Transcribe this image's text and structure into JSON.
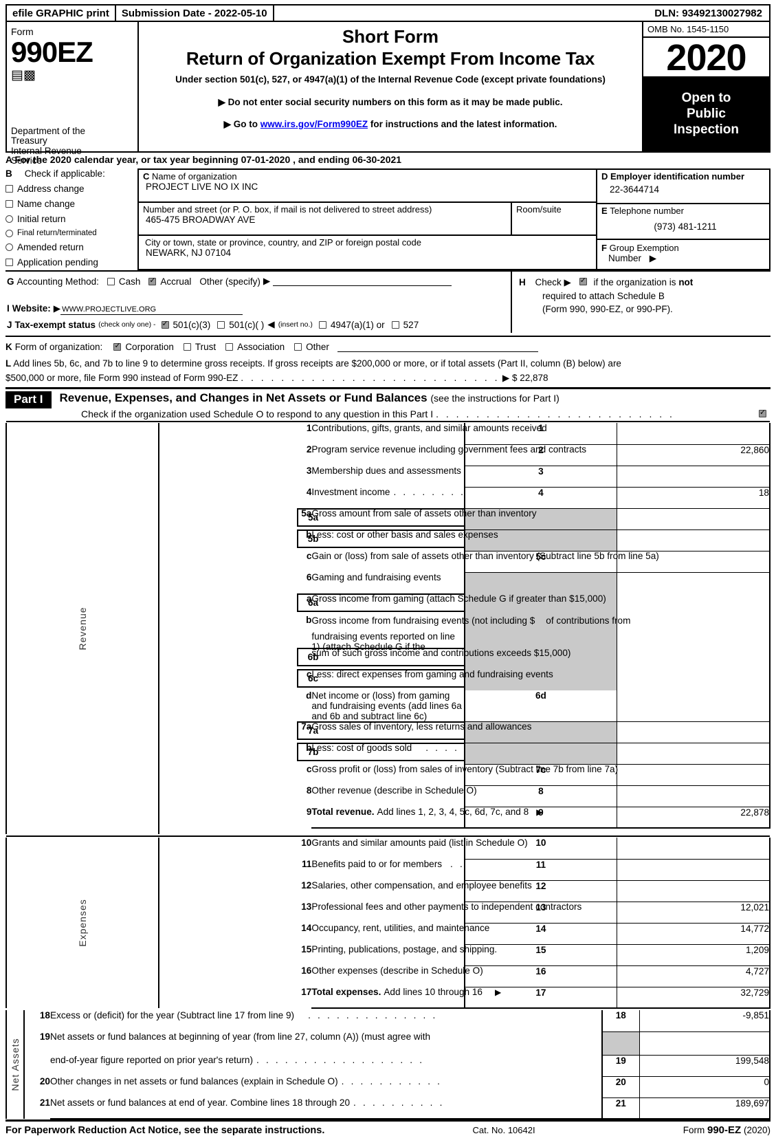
{
  "efile": {
    "graphic_print": "efile GRAPHIC print",
    "submission_date": "Submission Date - 2022-05-10",
    "dln": "DLN: 93492130027982"
  },
  "masthead": {
    "form_label": "Form",
    "form_number": "990EZ",
    "department_line1": "Department of the",
    "department_line2": "Treasury",
    "department_line3": "Internal Revenue",
    "department_line4": "Service",
    "title_short": "Short Form",
    "title_main": "Return of Organization Exempt From Income Tax",
    "subtitle": "Under section 501(c), 527, or 4947(a)(1) of the Internal Revenue Code (except private foundations)",
    "bullet1": "Do not enter social security numbers on this form as it may be made public.",
    "bullet2_prefix": "Go to",
    "bullet2_link": "www.irs.gov/Form990EZ",
    "bullet2_suffix": "for instructions and the latest information.",
    "omb": "OMB No. 1545-1150",
    "year": "2020",
    "open_line1": "Open to",
    "open_line2": "Public",
    "open_line3": "Inspection"
  },
  "line_a": "A  For the 2020 calendar year, or tax year beginning 07-01-2020 , and ending 06-30-2021",
  "section_b": {
    "letter": "B",
    "title": "Check if applicable:",
    "options": [
      {
        "label": "Address change",
        "checked": false,
        "shape": "square"
      },
      {
        "label": "Name change",
        "checked": false,
        "shape": "square"
      },
      {
        "label": "Initial return",
        "checked": false,
        "shape": "round"
      },
      {
        "label": "Final return/terminated",
        "checked": false,
        "shape": "round",
        "small": true
      },
      {
        "label": "Amended return",
        "checked": false,
        "shape": "round"
      },
      {
        "label": "Application pending",
        "checked": false,
        "shape": "square"
      }
    ]
  },
  "section_c": {
    "letter": "C",
    "label": "Name of organization",
    "value": "PROJECT LIVE NO IX INC",
    "street_label": "Number and street (or P. O. box, if mail is not delivered to street address)",
    "street_value": "465-475 BROADWAY AVE",
    "room_label": "Room/suite",
    "room_value": "",
    "city_label": "City or town, state or province, country, and ZIP or foreign postal code",
    "city_value": "NEWARK, NJ   07104"
  },
  "section_d": {
    "letter": "D",
    "label": "Employer identification number",
    "value": "22-3644714"
  },
  "section_e": {
    "letter": "E",
    "label": "Telephone number",
    "value": "(973) 481-1211"
  },
  "section_f": {
    "letter": "F",
    "label": "Group Exemption",
    "label2": "Number",
    "value": ""
  },
  "section_g": {
    "letter": "G",
    "label": "Accounting Method:",
    "cash": "Cash",
    "cash_checked": false,
    "accrual": "Accrual",
    "accrual_checked": true,
    "other": "Other (specify)",
    "other_value": ""
  },
  "section_h": {
    "letter": "H",
    "label": "Check",
    "checked": true,
    "text1": "if the organization is",
    "text_not": "not",
    "text2": "required to attach Schedule B",
    "text3": "(Form 990, 990-EZ, or 990-PF)."
  },
  "section_i": {
    "letter": "I",
    "label": "Website:",
    "value": "WWW.PROJECTLIVE.ORG"
  },
  "section_j": {
    "letter": "J",
    "label": "Tax-exempt status",
    "note": "(check only one) -",
    "options": [
      {
        "label": "501(c)(3)",
        "checked": true
      },
      {
        "label": "501(c)(   )",
        "checked": false
      },
      {
        "label": "4947(a)(1) or",
        "checked": false
      },
      {
        "label": "527",
        "checked": false
      }
    ],
    "insert_note": "(insert no.)"
  },
  "section_k": {
    "letter": "K",
    "label": "Form of organization:",
    "options": [
      {
        "label": "Corporation",
        "checked": true
      },
      {
        "label": "Trust",
        "checked": false
      },
      {
        "label": "Association",
        "checked": false
      },
      {
        "label": "Other",
        "checked": false
      }
    ]
  },
  "section_l": {
    "letter": "L",
    "text1": "Add lines 5b, 6c, and 7b to line 9 to determine gross receipts. If gross receipts are $200,000 or more, or if total assets (Part II, column (B) below) are",
    "text2": "$500,000 or more, file Form 990 instead of Form 990-EZ",
    "amount": "$ 22,878"
  },
  "part1": {
    "tag": "Part I",
    "title": "Revenue, Expenses, and Changes in Net Assets or Fund Balances",
    "title_note": "(see the instructions for Part I)",
    "check_text": "Check if the organization used Schedule O to respond to any question in this Part I",
    "checked": true
  },
  "sections": {
    "revenue_label": "Revenue",
    "expenses_label": "Expenses",
    "netassets_label": "Net Assets"
  },
  "revenue_rows": [
    {
      "num": "1",
      "desc": "Contributions, gifts, grants, and similar amounts received",
      "box": "1",
      "value": "",
      "dots": true
    },
    {
      "num": "2",
      "desc": "Program service revenue including government fees and contracts",
      "box": "2",
      "value": "22,860",
      "dots": true
    },
    {
      "num": "3",
      "desc": "Membership dues and assessments",
      "box": "3",
      "value": "",
      "dots": true
    },
    {
      "num": "4",
      "desc": "Investment income",
      "box": "4",
      "value": "18",
      "dots": true
    },
    {
      "num": "5a",
      "desc": "Gross amount from sale of assets other than inventory",
      "sub_box": "5a",
      "sub_value": "",
      "gray": true,
      "dots": true
    },
    {
      "num": "b",
      "desc": "Less: cost or other basis and sales expenses",
      "sub_box": "5b",
      "sub_value": "",
      "gray": true,
      "dots": true
    },
    {
      "num": "c",
      "desc": "Gain or (loss) from sale of assets other than inventory (Subtract line 5b from line 5a)",
      "box": "5c",
      "value": "",
      "dots": true
    },
    {
      "num": "6",
      "desc": "Gaming and fundraising events",
      "gray": true,
      "dots": false
    },
    {
      "num": "a",
      "desc": "Gross income from gaming (attach Schedule G if greater than $15,000)",
      "sub_box": "6a",
      "sub_value": "",
      "gray": true,
      "dots": false
    },
    {
      "num": "b",
      "desc": "Gross income from fundraising events (not including $",
      "desc2": "of contributions from",
      "desc3": "fundraising events reported on line 1) (attach Schedule G if the",
      "desc4": "sum of such gross income and contributions exceeds $15,000)",
      "sub_box": "6b",
      "sub_value": "",
      "gray": true,
      "dots": true
    },
    {
      "num": "c",
      "desc": "Less: direct expenses from gaming and fundraising events",
      "sub_box": "6c",
      "sub_value": "",
      "gray": true,
      "dots": true
    },
    {
      "num": "d",
      "desc": "Net income or (loss) from gaming and fundraising events (add lines 6a and 6b and subtract line 6c)",
      "box": "6d",
      "value": "",
      "dots": false
    },
    {
      "num": "7a",
      "desc": "Gross sales of inventory, less returns and allowances",
      "sub_box": "7a",
      "sub_value": "",
      "gray": true,
      "dots": true
    },
    {
      "num": "b",
      "desc": "Less: cost of goods sold",
      "sub_box": "7b",
      "sub_value": "",
      "gray": true,
      "dots": true
    },
    {
      "num": "c",
      "desc": "Gross profit or (loss) from sales of inventory (Subtract line 7b from line 7a)",
      "box": "7c",
      "value": "",
      "dots": true
    },
    {
      "num": "8",
      "desc": "Other revenue (describe in Schedule O)",
      "box": "8",
      "value": "",
      "dots": true
    },
    {
      "num": "9",
      "desc_bold": "Total revenue.",
      "desc": "Add lines 1, 2, 3, 4, 5c, 6d, 7c, and 8",
      "box": "9",
      "value": "22,878",
      "dots": true,
      "arrow": true
    }
  ],
  "expense_rows": [
    {
      "num": "10",
      "desc": "Grants and similar amounts paid (list in Schedule O)",
      "box": "10",
      "value": "",
      "dots": true
    },
    {
      "num": "11",
      "desc": "Benefits paid to or for members",
      "box": "11",
      "value": "",
      "dots": true
    },
    {
      "num": "12",
      "desc": "Salaries, other compensation, and employee benefits",
      "box": "12",
      "value": "",
      "dots": true
    },
    {
      "num": "13",
      "desc": "Professional fees and other payments to independent contractors",
      "box": "13",
      "value": "12,021",
      "dots": true
    },
    {
      "num": "14",
      "desc": "Occupancy, rent, utilities, and maintenance",
      "box": "14",
      "value": "14,772",
      "dots": true
    },
    {
      "num": "15",
      "desc": "Printing, publications, postage, and shipping.",
      "box": "15",
      "value": "1,209",
      "dots": true
    },
    {
      "num": "16",
      "desc": "Other expenses (describe in Schedule O)",
      "box": "16",
      "value": "4,727",
      "dots": true
    },
    {
      "num": "17",
      "desc_bold": "Total expenses.",
      "desc": "Add lines 10 through 16",
      "box": "17",
      "value": "32,729",
      "dots": true,
      "arrow": true
    }
  ],
  "netasset_rows": [
    {
      "num": "18",
      "desc": "Excess or (deficit) for the year (Subtract line 17 from line 9)",
      "box": "18",
      "value": "-9,851",
      "dots": true
    },
    {
      "num": "19",
      "desc": "Net assets or fund balances at beginning of year (from line 27, column (A)) (must agree with",
      "desc2": "end-of-year figure reported on prior year's return)",
      "box": "19",
      "value": "199,548",
      "dots": true,
      "two_line": true
    },
    {
      "num": "20",
      "desc": "Other changes in net assets or fund balances (explain in Schedule O)",
      "box": "20",
      "value": "0",
      "dots": true
    },
    {
      "num": "21",
      "desc": "Net assets or fund balances at end of year. Combine lines 18 through 20",
      "box": "21",
      "value": "189,697",
      "dots": true
    }
  ],
  "footer": {
    "notice": "For Paperwork Reduction Act Notice, see the separate instructions.",
    "cat": "Cat. No. 10642I",
    "form_prefix": "Form",
    "form_num": "990-EZ",
    "form_year": "(2020)"
  }
}
